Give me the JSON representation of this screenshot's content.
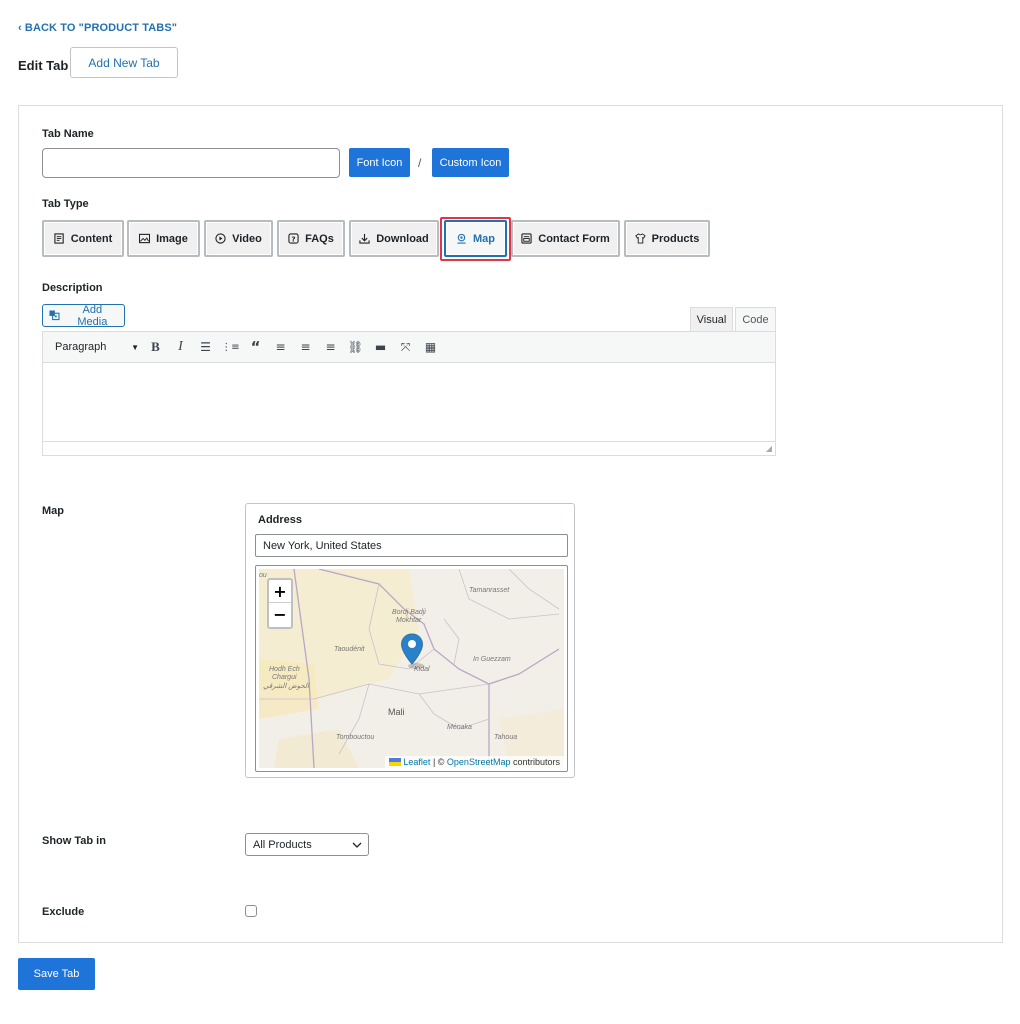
{
  "header": {
    "back_link": "BACK TO \"PRODUCT TABS\"",
    "title": "Edit Tab",
    "add_new_label": "Add New Tab"
  },
  "form": {
    "tab_name_label": "Tab Name",
    "tab_name_value": "",
    "font_icon_label": "Font Icon",
    "separator": "/",
    "custom_icon_label": "Custom Icon",
    "tab_type_label": "Tab Type",
    "tab_types": [
      {
        "label": "Content",
        "icon": "content-icon"
      },
      {
        "label": "Image",
        "icon": "image-icon"
      },
      {
        "label": "Video",
        "icon": "video-icon"
      },
      {
        "label": "FAQs",
        "icon": "faq-icon"
      },
      {
        "label": "Download",
        "icon": "download-icon"
      },
      {
        "label": "Map",
        "icon": "map-pin-icon",
        "selected": true
      },
      {
        "label": "Contact Form",
        "icon": "contact-form-icon"
      },
      {
        "label": "Products",
        "icon": "shirt-icon"
      }
    ],
    "description_label": "Description",
    "add_media_label": "Add Media",
    "editor_tabs": {
      "visual": "Visual",
      "code": "Code"
    },
    "paragraph_select": "Paragraph",
    "map_label": "Map",
    "address_label": "Address",
    "address_value": "New York, United States",
    "show_tab_in_label": "Show Tab in",
    "show_tab_in_value": "All Products",
    "exclude_label": "Exclude",
    "exclude_checked": false,
    "save_label": "Save Tab"
  },
  "map": {
    "zoom_in": "+",
    "zoom_out": "−",
    "attribution_leaflet": "Leaflet",
    "attribution_sep": " | © ",
    "attribution_osm": "OpenStreetMap",
    "attribution_suffix": " contributors",
    "places": {
      "tamanrasset": "Tamanrasset",
      "bordj": "Bordj Badji",
      "mokhtar": "Mokhtar",
      "taoudenit": "Taoudénit",
      "in_guezzam": "In Guezzam",
      "kidal": "Kidal",
      "hodh1": "Hodh Ech",
      "hodh2": "Chargui",
      "hodh3": "الحوض الشرقي",
      "mali": "Mali",
      "menaka": "Ménaka",
      "tombouctou": "Tombouctou",
      "tahoua": "Tahoua",
      "edge": "ou"
    }
  },
  "colors": {
    "primary": "#1e74d8",
    "link": "#2271b1",
    "highlight": "#e0344a",
    "marker": "#2a81cb"
  }
}
